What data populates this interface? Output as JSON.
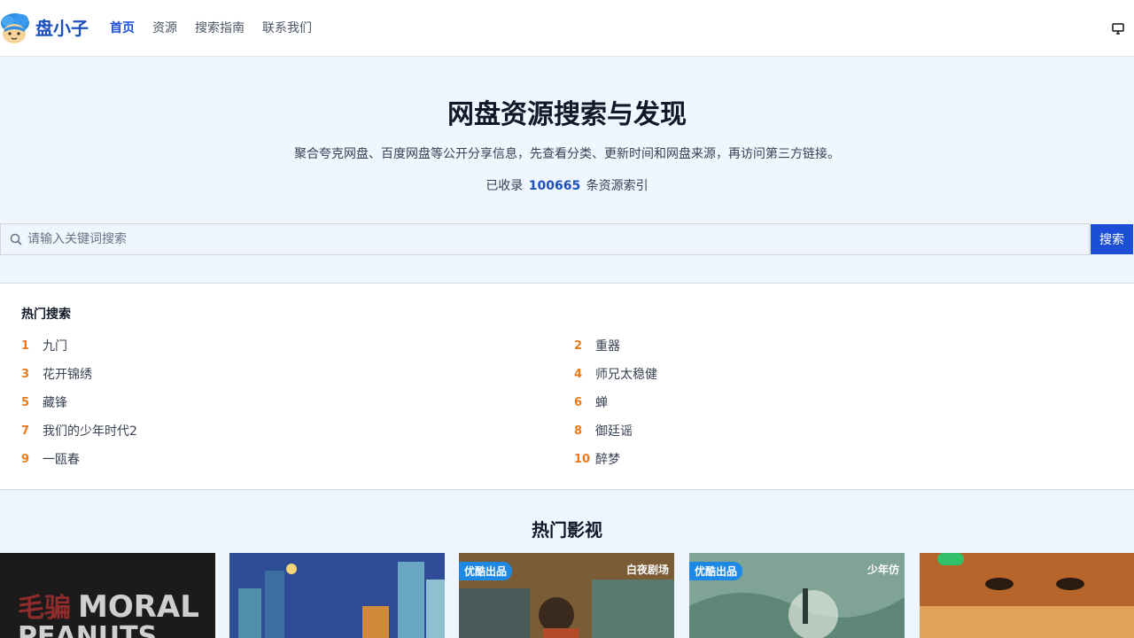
{
  "header": {
    "brand": "盘小子",
    "nav": [
      {
        "label": "首页",
        "active": true
      },
      {
        "label": "资源",
        "active": false
      },
      {
        "label": "搜索指南",
        "active": false
      },
      {
        "label": "联系我们",
        "active": false
      }
    ]
  },
  "hero": {
    "title": "网盘资源搜索与发现",
    "subtitle": "聚合夸克网盘、百度网盘等公开分享信息，先查看分类、更新时间和网盘来源，再访问第三方链接。",
    "count_prefix": "已收录",
    "count_value": "100665",
    "count_suffix": "条资源索引",
    "search": {
      "placeholder": "请输入关键词搜索",
      "button": "搜索"
    }
  },
  "hot_searches": {
    "title": "热门搜索",
    "items": [
      {
        "rank": "1",
        "term": "九门"
      },
      {
        "rank": "2",
        "term": "重器"
      },
      {
        "rank": "3",
        "term": "花开锦绣"
      },
      {
        "rank": "4",
        "term": "师兄太稳健"
      },
      {
        "rank": "5",
        "term": "藏锋"
      },
      {
        "rank": "6",
        "term": "蝉"
      },
      {
        "rank": "7",
        "term": "我们的少年时代2"
      },
      {
        "rank": "8",
        "term": "御廷谣"
      },
      {
        "rank": "9",
        "term": "一瓯春"
      },
      {
        "rank": "10",
        "term": "醉梦"
      }
    ]
  },
  "hot_films": {
    "title": "热门影视",
    "posters": [
      {
        "overlay": "毛骗 MORAL PEANUTS",
        "tag": "",
        "tag_right": "",
        "bg": "#1a1a1a"
      },
      {
        "overlay": "",
        "tag": "",
        "tag_right": "",
        "bg": "#2f4f9a"
      },
      {
        "overlay": "",
        "tag": "优酷出品",
        "tag_right": "白夜剧场",
        "bg": "#8a6a3c"
      },
      {
        "overlay": "",
        "tag": "优酷出品",
        "tag_right": "少年仿",
        "bg": "#7fa394"
      },
      {
        "overlay": "",
        "tag": "",
        "tag_right": "",
        "bg": "#c2702e"
      }
    ]
  },
  "colors": {
    "accent": "#1d4ed8",
    "rank": "#ea7a17",
    "hero_bg": "#eff6ff"
  }
}
